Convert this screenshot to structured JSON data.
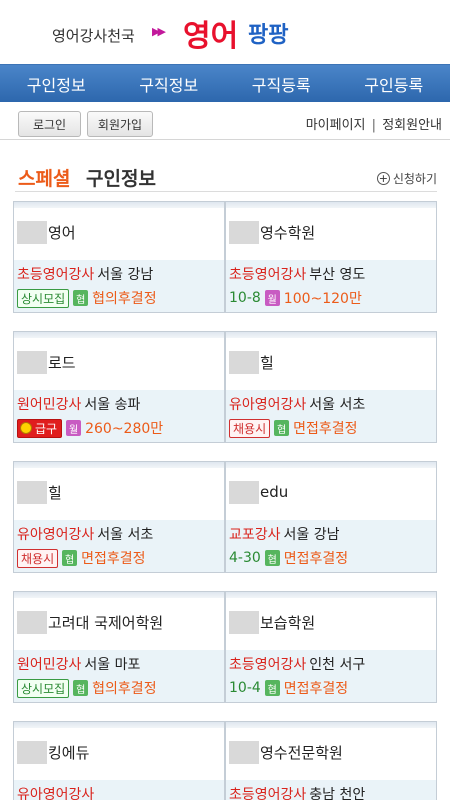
{
  "header": {
    "logo_small": "영어강사천국",
    "logo_arrows": "▶▶",
    "logo_big1": "영어",
    "logo_big2": "팡팡"
  },
  "nav": [
    "구인정보",
    "구직정보",
    "구직등록",
    "구인등록"
  ],
  "subbar": {
    "login": "로그인",
    "join": "회원가입",
    "mypage": "마이페이지",
    "separator": "|",
    "member_info": "정회원안내"
  },
  "section": {
    "special": "스페셜",
    "title": "구인정보",
    "apply_icon": "+",
    "apply": "신청하기"
  },
  "pay_icon_labels": {
    "hyup": "협",
    "wol": "월"
  },
  "cards": [
    {
      "name": "영어",
      "job_type": "초등영어강사",
      "location": "서울 강남",
      "badge": "상시모집",
      "pay_icon": "협",
      "pay": "협의후결정"
    },
    {
      "name": "영수학원",
      "job_type": "초등영어강사",
      "location": "부산 영도",
      "deadline": "10-8",
      "pay_icon": "월",
      "pay": "100~120만"
    },
    {
      "name": "로드",
      "job_type": "원어민강사",
      "location": "서울 송파",
      "badge": "급구",
      "pay_icon": "월",
      "pay": "260~280만"
    },
    {
      "name": "힐",
      "job_type": "유아영어강사",
      "location": "서울 서초",
      "badge": "채용시",
      "pay_icon": "협",
      "pay": "면접후결정"
    },
    {
      "name": "힐",
      "job_type": "유아영어강사",
      "location": "서울 서초",
      "badge": "채용시",
      "pay_icon": "협",
      "pay": "면접후결정"
    },
    {
      "name": "edu",
      "job_type": "교포강사",
      "location": "서울 강남",
      "deadline": "4-30",
      "pay_icon": "협",
      "pay": "면접후결정"
    },
    {
      "name": "고려대 국제어학원",
      "job_type": "원어민강사",
      "location": "서울 마포",
      "badge": "상시모집",
      "pay_icon": "협",
      "pay": "협의후결정"
    },
    {
      "name": "보습학원",
      "job_type": "초등영어강사",
      "location": "인천 서구",
      "deadline": "10-4",
      "pay_icon": "협",
      "pay": "면접후결정"
    },
    {
      "name": "킹에듀",
      "job_type": "유아영어강사",
      "location": ""
    },
    {
      "name": "영수전문학원",
      "job_type": "초등영어강사",
      "location": "충남 천안"
    }
  ]
}
